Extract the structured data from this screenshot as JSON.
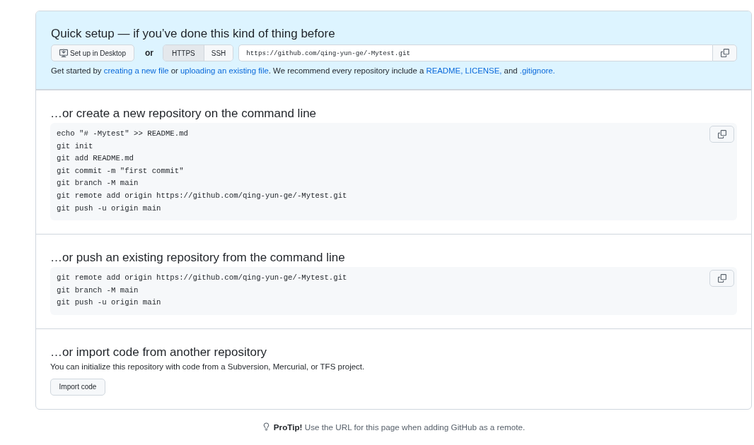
{
  "quick_setup": {
    "title": "Quick setup — if you’ve done this kind of thing before",
    "desktop_button": "Set up in Desktop",
    "or_label": "or",
    "protocol_tabs": [
      {
        "label": "HTTPS",
        "selected": true
      },
      {
        "label": "SSH",
        "selected": false
      }
    ],
    "clone_url": "https://github.com/qing-yun-ge/-Mytest.git",
    "intro": [
      {
        "kind": "text",
        "text": "Get started by "
      },
      {
        "kind": "link",
        "text": "creating a new file"
      },
      {
        "kind": "text",
        "text": " or "
      },
      {
        "kind": "link",
        "text": "uploading an existing file"
      },
      {
        "kind": "text",
        "text": ". We recommend every repository include a "
      },
      {
        "kind": "link",
        "text": "README,"
      },
      {
        "kind": "link",
        "text": "LICENSE,"
      },
      {
        "kind": "text",
        "text": " and "
      },
      {
        "kind": "link",
        "text": ".gitignore."
      }
    ]
  },
  "sections": [
    {
      "kind": "code",
      "title": "…or create a new repository on the command line",
      "lines": [
        "echo \"# -Mytest\" >> README.md",
        "git init",
        "git add README.md",
        "git commit -m \"first commit\"",
        "git branch -M main",
        "git remote add origin https://github.com/qing-yun-ge/-Mytest.git",
        "git push -u origin main"
      ]
    },
    {
      "kind": "code",
      "title": "…or push an existing repository from the command line",
      "lines": [
        "git remote add origin https://github.com/qing-yun-ge/-Mytest.git",
        "git branch -M main",
        "git push -u origin main"
      ]
    },
    {
      "kind": "import",
      "title": "…or import code from another repository",
      "description": "You can initialize this repository with code from a Subversion, Mercurial, or TFS project.",
      "button": "Import code"
    }
  ],
  "protip": "**ProTip!** Use the URL for this page when adding GitHub as a remote."
}
